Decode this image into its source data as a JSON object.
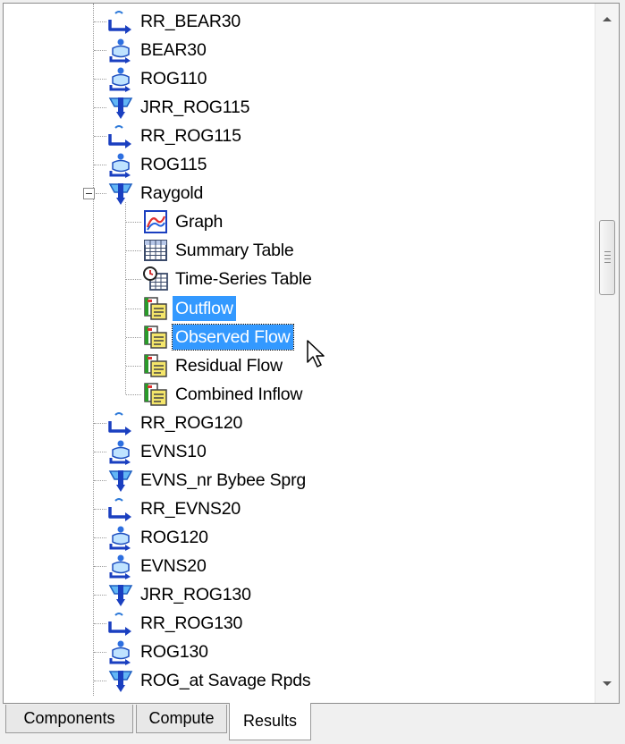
{
  "tree": {
    "items": [
      {
        "label": "RR_BEAR30",
        "icon": "reach-icon"
      },
      {
        "label": "BEAR30",
        "icon": "junction-icon"
      },
      {
        "label": "ROG110",
        "icon": "junction-icon"
      },
      {
        "label": "JRR_ROG115",
        "icon": "reservoir-icon"
      },
      {
        "label": "RR_ROG115",
        "icon": "reach-icon"
      },
      {
        "label": "ROG115",
        "icon": "junction-icon"
      },
      {
        "label": "Raygold",
        "icon": "reservoir-icon",
        "expanded": true
      },
      {
        "label": "Graph",
        "icon": "graph-icon",
        "child": true
      },
      {
        "label": "Summary Table",
        "icon": "table-icon",
        "child": true
      },
      {
        "label": "Time-Series Table",
        "icon": "time-series-table-icon",
        "child": true
      },
      {
        "label": "Outflow",
        "icon": "result-variable-icon",
        "child": true,
        "selected": true
      },
      {
        "label": "Observed Flow",
        "icon": "result-variable-icon",
        "child": true,
        "selected": true,
        "focused": true
      },
      {
        "label": "Residual Flow",
        "icon": "result-variable-icon",
        "child": true
      },
      {
        "label": "Combined Inflow",
        "icon": "result-variable-icon",
        "child": true
      },
      {
        "label": "RR_ROG120",
        "icon": "reach-icon"
      },
      {
        "label": "EVNS10",
        "icon": "junction-icon"
      },
      {
        "label": "EVNS_nr Bybee Sprg",
        "icon": "reservoir-icon"
      },
      {
        "label": "RR_EVNS20",
        "icon": "reach-icon"
      },
      {
        "label": "ROG120",
        "icon": "junction-icon"
      },
      {
        "label": "EVNS20",
        "icon": "junction-icon"
      },
      {
        "label": "JRR_ROG130",
        "icon": "reservoir-icon"
      },
      {
        "label": "RR_ROG130",
        "icon": "reach-icon"
      },
      {
        "label": "ROG130",
        "icon": "junction-icon"
      },
      {
        "label": "ROG_at Savage Rpds",
        "icon": "reservoir-icon"
      }
    ]
  },
  "tabs": [
    {
      "label": "Components",
      "active": false
    },
    {
      "label": "Compute",
      "active": false
    },
    {
      "label": "Results",
      "active": true
    }
  ],
  "colors": {
    "selection": "#3399ff",
    "accent_blue": "#1a4fd0"
  }
}
